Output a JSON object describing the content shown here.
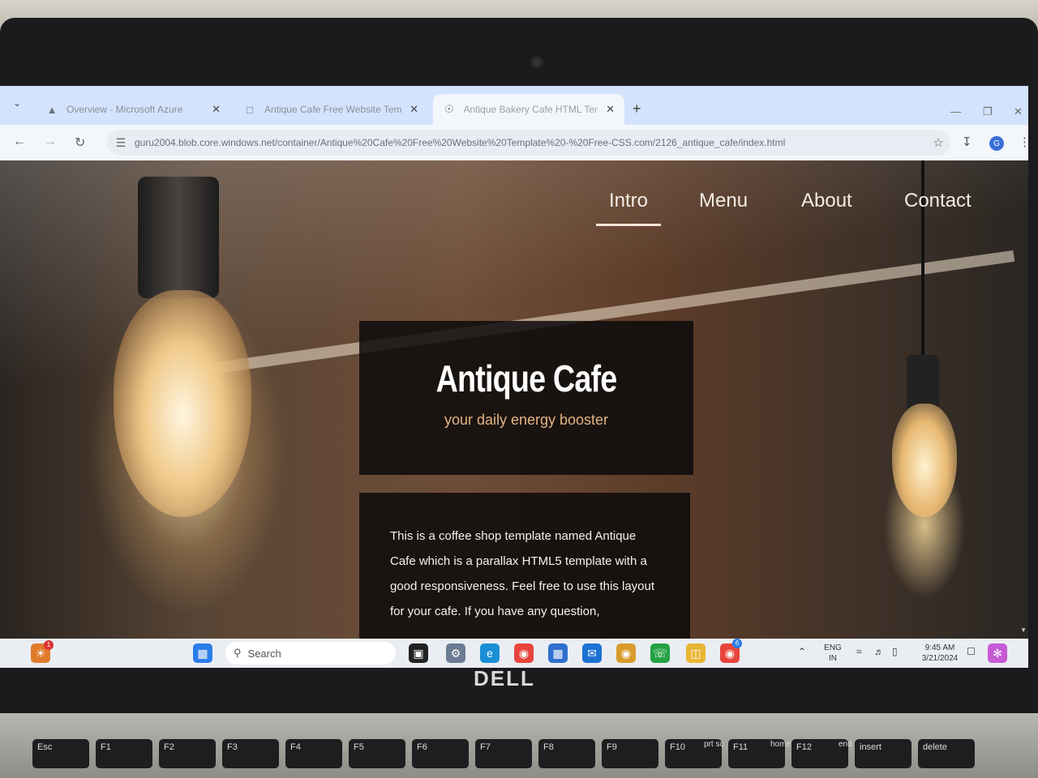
{
  "browser": {
    "tabs": [
      {
        "label": "Overview - Microsoft Azure",
        "icon": "azure-icon",
        "active": false
      },
      {
        "label": "Antique Cafe Free Website Tem",
        "icon": "page-icon",
        "active": false
      },
      {
        "label": "Antique Bakery Cafe HTML Tem",
        "icon": "globe-icon",
        "active": true
      }
    ],
    "url": "guru2004.blob.core.windows.net/container/Antique%20Cafe%20Free%20Website%20Template%20-%20Free-CSS.com/2126_antique_cafe/index.html",
    "profile_initial": "G"
  },
  "site": {
    "nav": [
      "Intro",
      "Menu",
      "About",
      "Contact"
    ],
    "active_nav": "Intro",
    "hero": {
      "title": "Antique Cafe",
      "tagline": "your daily energy booster"
    },
    "intro_text": "This is a coffee shop template named Antique Cafe which is a parallax HTML5 template with a good responsiveness. Feel free to use this layout for your cafe. If you have any question,"
  },
  "taskbar": {
    "search_placeholder": "Search",
    "notification_count": "1",
    "chrome_badge": "6",
    "language": "ENG",
    "region": "IN",
    "time": "9:45 AM",
    "date": "3/21/2024"
  },
  "laptop": {
    "brand": "DELL",
    "keys": [
      "Esc",
      "F1",
      "F2",
      "F3",
      "F4",
      "F5",
      "F6",
      "F7",
      "F8",
      "F9",
      "F10",
      "F11",
      "F12",
      "insert",
      "delete"
    ],
    "key_alt_labels": [
      "prt sc",
      "home",
      "end"
    ]
  }
}
